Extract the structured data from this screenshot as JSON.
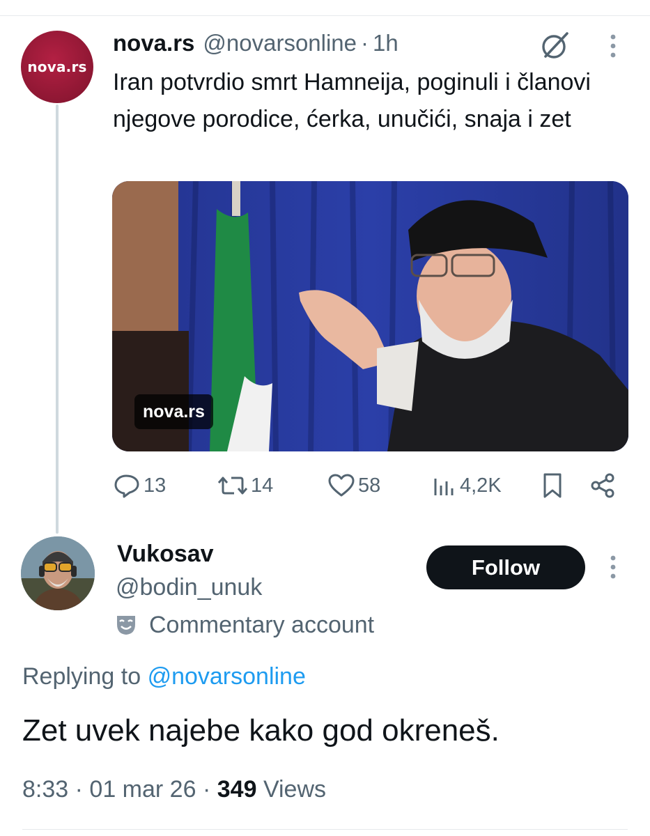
{
  "parent_tweet": {
    "avatar_text": "nova.rs",
    "name": "nova.rs",
    "handle": "@novarsonline",
    "separator": "·",
    "time": "1h",
    "text": "Iran potvrdio smrt Hamneija, poginuli i članovi njegove porodice, ćerka, unučići, snaja i zet",
    "media_label": "nova.rs",
    "actions": {
      "replies": "13",
      "reposts": "14",
      "likes": "58",
      "views": "4,2K"
    }
  },
  "reply_tweet": {
    "name": "Vukosav",
    "handle": "@bodin_unuk",
    "account_label": "Commentary account",
    "follow_label": "Follow",
    "replying_prefix": "Replying to",
    "replying_handle": "@novarsonline",
    "text": "Zet uvek najebe kako god okreneš.",
    "time": "8:33",
    "date": "01 mar 26",
    "views_count": "349",
    "views_label": "Views",
    "separator": "·"
  },
  "colors": {
    "text_primary": "#0f1419",
    "text_secondary": "#536471",
    "link": "#1d9bf0",
    "brand_nova": "#9c1a38",
    "follow_bg": "#0f1419"
  },
  "icons": [
    "grok-icon",
    "more-icon",
    "reply-icon",
    "repost-icon",
    "like-icon",
    "views-icon",
    "bookmark-icon",
    "share-icon",
    "commentary-mask-icon"
  ]
}
